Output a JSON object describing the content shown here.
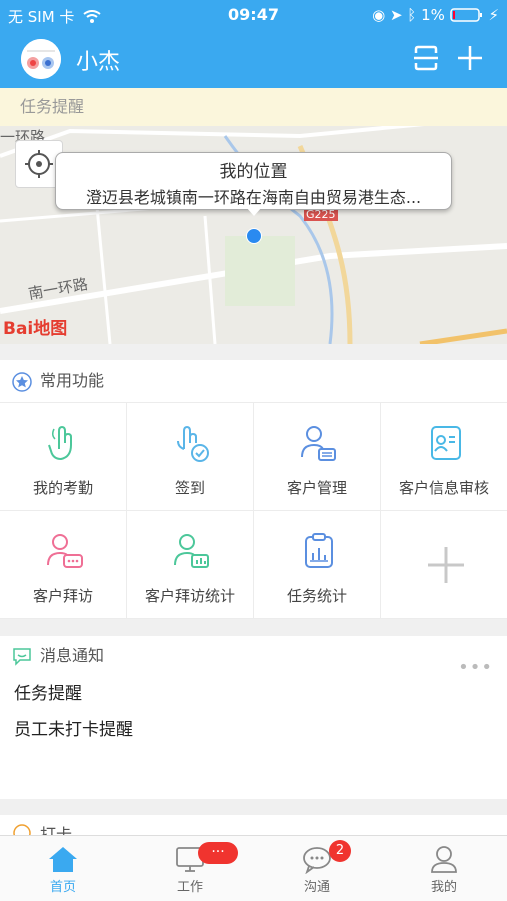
{
  "status_bar": {
    "carrier": "无 SIM 卡",
    "time": "09:47",
    "battery": "1%"
  },
  "header": {
    "title": "小杰"
  },
  "reminder_bar": {
    "text": "任务提醒"
  },
  "map": {
    "callout_title": "我的位置",
    "callout_address": "澄迈县老城镇南一环路在海南自由贸易港生态...",
    "road_labels": [
      "一环路",
      "南一环路",
      "G225"
    ],
    "logo": "Bai地图"
  },
  "common_functions": {
    "title": "常用功能",
    "items": [
      {
        "label": "我的考勤",
        "icon": "tap-hand-icon",
        "color": "#4cc79a"
      },
      {
        "label": "签到",
        "icon": "checkin-icon",
        "color": "#5ab5e8"
      },
      {
        "label": "客户管理",
        "icon": "customer-card-icon",
        "color": "#5b8fe0"
      },
      {
        "label": "客户信息审核",
        "icon": "id-card-icon",
        "color": "#49b8e6"
      },
      {
        "label": "客户拜访",
        "icon": "visit-chat-icon",
        "color": "#ef6f95"
      },
      {
        "label": "客户拜访统计",
        "icon": "visit-stats-icon",
        "color": "#4cc79a"
      },
      {
        "label": "任务统计",
        "icon": "clipboard-chart-icon",
        "color": "#5b8fe0"
      },
      {
        "label": "",
        "icon": "add-icon",
        "color": "#c8c8c8"
      }
    ]
  },
  "messages": {
    "title": "消息通知",
    "items": [
      "任务提醒",
      "员工未打卡提醒"
    ]
  },
  "peek_title": "打卡",
  "tabs": [
    {
      "label": "首页",
      "icon": "home-icon",
      "active": true
    },
    {
      "label": "工作",
      "icon": "monitor-icon",
      "badge": "···"
    },
    {
      "label": "沟通",
      "icon": "chat-icon",
      "badge": "2"
    },
    {
      "label": "我的",
      "icon": "user-icon"
    }
  ],
  "colors": {
    "primary": "#3aa9f0",
    "badge": "#f0342f",
    "reminder_bg": "#fbf6dc"
  }
}
